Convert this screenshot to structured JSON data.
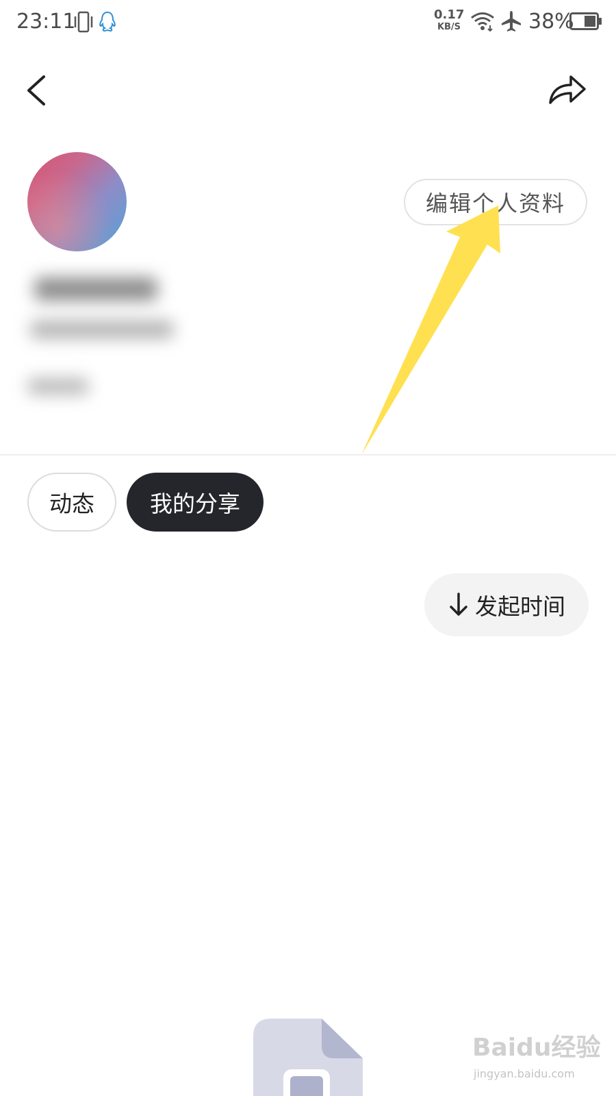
{
  "status_bar": {
    "time": "23:11",
    "net_speed_value": "0.17",
    "net_speed_unit": "KB/S",
    "battery_percent": "38%",
    "icons": [
      "vibrate-icon",
      "qq-icon",
      "wifi-icon",
      "airplane-icon",
      "battery-icon"
    ]
  },
  "header": {
    "back_icon": "chevron-left-icon",
    "share_icon": "share-forward-icon"
  },
  "profile": {
    "edit_button_label": "编辑个人资料"
  },
  "tabs": [
    {
      "label": "动态",
      "active": false
    },
    {
      "label": "我的分享",
      "active": true
    }
  ],
  "sort": {
    "label": "发起时间",
    "icon": "arrow-down-icon"
  },
  "colors": {
    "annotation_arrow": "#ffe050",
    "active_tab_bg": "#25262b",
    "sort_bg": "#f3f3f3"
  },
  "watermark": {
    "logo": "Baidu经验",
    "domain": "jingyan.baidu.com"
  }
}
